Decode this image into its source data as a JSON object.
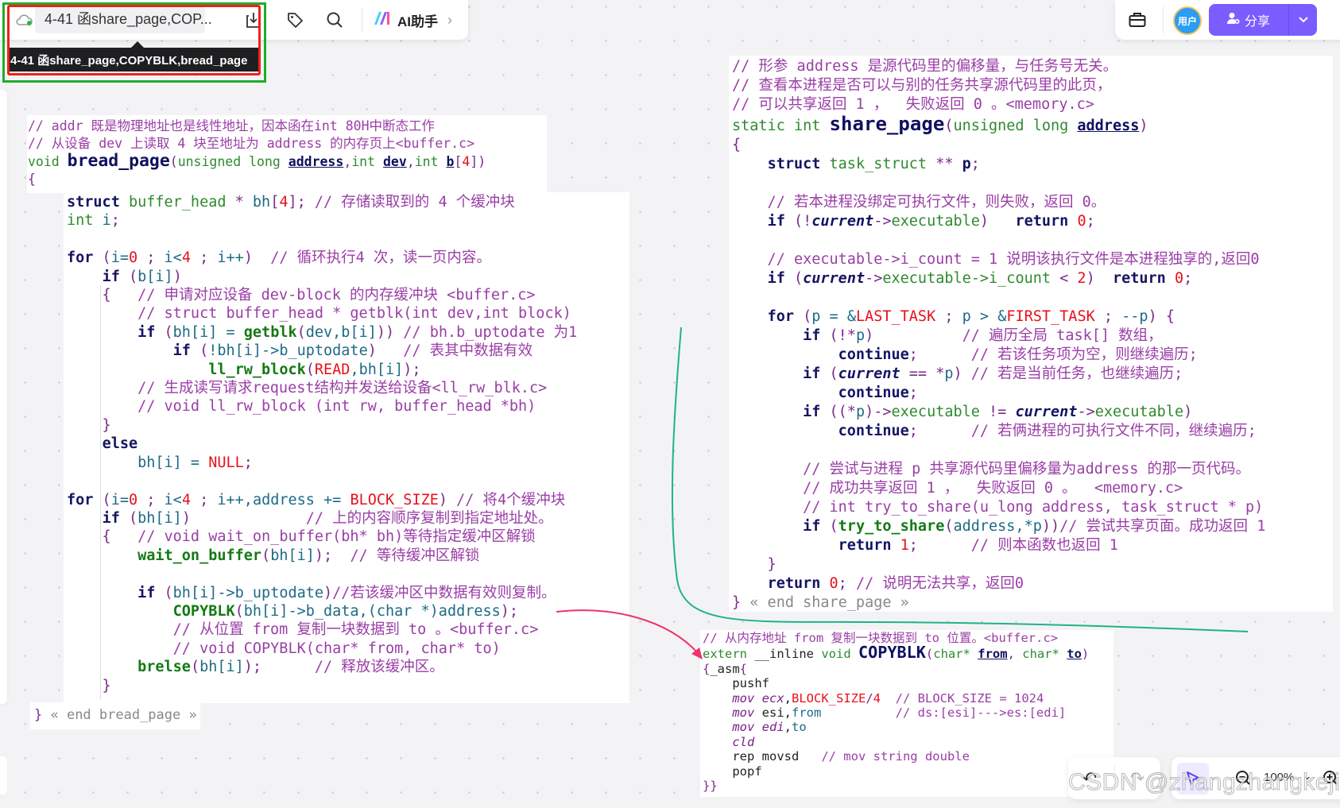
{
  "toolbar": {
    "doc_title": "4-41 函share_page,COP...",
    "tooltip": "4-41  函share_page,COPYBLK,bread_page",
    "ai_label": "AI助手",
    "avatar_text": "用户",
    "share_label": "分享",
    "zoom_level": "100%",
    "icons": [
      "cloud-sync-icon",
      "download-icon",
      "tag-icon",
      "search-icon",
      "ai-logo-icon",
      "chevron-right-icon",
      "toolbox-icon",
      "user-plus-icon",
      "chevron-down-icon",
      "undo-icon",
      "redo-icon",
      "pointer-icon",
      "zoom-out-icon",
      "zoom-in-icon"
    ],
    "accent_color": "#7b5cff"
  },
  "watermark": "CSDN @zhangzhangkeji",
  "bread_page_header": [
    [
      [
        "c",
        "// addr 既是物理地址也是线性地址，因本函在int 80H中断态工作"
      ]
    ],
    [
      [
        "c",
        "// 从设备 dev 上读取 4 块至地址为 address 的内存页上<buffer.c>"
      ]
    ],
    [
      [
        "t",
        "void "
      ],
      [
        "F",
        "bread_page"
      ],
      [
        "p",
        "("
      ],
      [
        "t",
        "unsigned long "
      ],
      [
        "u",
        "address"
      ],
      [
        "p",
        ","
      ],
      [
        "t",
        "int "
      ],
      [
        "u",
        "dev"
      ],
      [
        "p",
        ","
      ],
      [
        "t",
        "int "
      ],
      [
        "u",
        "b"
      ],
      [
        "p",
        "["
      ],
      [
        "n",
        "4"
      ],
      [
        "p",
        "])"
      ]
    ],
    [
      [
        "p",
        "{"
      ]
    ]
  ],
  "bread_page_body": [
    [
      [
        "k",
        "struct"
      ],
      [
        "t",
        " buffer_head "
      ],
      [
        "p",
        "* "
      ],
      [
        "v",
        "bh"
      ],
      [
        "p",
        "["
      ],
      [
        "n",
        "4"
      ],
      [
        "p",
        "]; "
      ],
      [
        "c",
        "// 存储读取到的 4 个缓冲块"
      ]
    ],
    [
      [
        "t",
        "int "
      ],
      [
        "v",
        "i"
      ],
      [
        "p",
        ";"
      ]
    ],
    [],
    [
      [
        "k",
        "for"
      ],
      [
        "p",
        " ("
      ],
      [
        "v",
        "i="
      ],
      [
        "n",
        "0"
      ],
      [
        "p",
        " ; "
      ],
      [
        "v",
        "i<"
      ],
      [
        "n",
        "4"
      ],
      [
        "p",
        " ; "
      ],
      [
        "v",
        "i++"
      ],
      [
        "p",
        ")  "
      ],
      [
        "c",
        "// 循环执行4 次，读一页内容。"
      ]
    ],
    [
      [
        "m",
        "    "
      ],
      [
        "k",
        "if"
      ],
      [
        "p",
        " ("
      ],
      [
        "v",
        "b[i]"
      ],
      [
        "p",
        ")"
      ]
    ],
    [
      [
        "p",
        "    {   "
      ],
      [
        "c",
        "// 申请对应设备 dev-block 的内存缓冲块 <buffer.c>"
      ]
    ],
    [
      [
        "c",
        "        // struct buffer_head * getblk(int dev,int block)"
      ]
    ],
    [
      [
        "m",
        "        "
      ],
      [
        "k",
        "if"
      ],
      [
        "p",
        " ("
      ],
      [
        "v",
        "bh[i] = "
      ],
      [
        "f",
        "getblk"
      ],
      [
        "p",
        "("
      ],
      [
        "v",
        "dev,b[i]"
      ],
      [
        "p",
        ")) "
      ],
      [
        "c",
        "// bh.b_uptodate 为1"
      ]
    ],
    [
      [
        "m",
        "            "
      ],
      [
        "k",
        "if"
      ],
      [
        "p",
        " ("
      ],
      [
        "v",
        "!bh[i]->b_uptodate"
      ],
      [
        "p",
        ")   "
      ],
      [
        "c",
        "// 表其中数据有效"
      ]
    ],
    [
      [
        "m",
        "                "
      ],
      [
        "f",
        "ll_rw_block"
      ],
      [
        "p",
        "("
      ],
      [
        "n",
        "READ"
      ],
      [
        "v",
        ",bh[i]"
      ],
      [
        "p",
        ");"
      ]
    ],
    [
      [
        "c",
        "        // 生成读写请求request结构并发送给设备<ll_rw_blk.c>"
      ]
    ],
    [
      [
        "c",
        "        // void ll_rw_block (int rw, buffer_head *bh)"
      ]
    ],
    [
      [
        "p",
        "    }"
      ]
    ],
    [
      [
        "m",
        "    "
      ],
      [
        "k",
        "else"
      ]
    ],
    [
      [
        "m",
        "        "
      ],
      [
        "v",
        "bh[i] = "
      ],
      [
        "n",
        "NULL"
      ],
      [
        "p",
        ";"
      ]
    ],
    [],
    [
      [
        "k",
        "for"
      ],
      [
        "p",
        " ("
      ],
      [
        "v",
        "i="
      ],
      [
        "n",
        "0"
      ],
      [
        "p",
        " ; "
      ],
      [
        "v",
        "i<"
      ],
      [
        "n",
        "4"
      ],
      [
        "p",
        " ; "
      ],
      [
        "v",
        "i++,address += "
      ],
      [
        "n",
        "BLOCK_SIZE"
      ],
      [
        "p",
        ") "
      ],
      [
        "c",
        "// 将4个缓冲块"
      ]
    ],
    [
      [
        "m",
        "    "
      ],
      [
        "k",
        "if"
      ],
      [
        "p",
        " ("
      ],
      [
        "v",
        "bh[i]"
      ],
      [
        "p",
        ")             "
      ],
      [
        "c",
        "// 上的内容顺序复制到指定地址处。"
      ]
    ],
    [
      [
        "p",
        "    {   "
      ],
      [
        "c",
        "// void wait_on_buffer(bh* bh)等待指定缓冲区解锁"
      ]
    ],
    [
      [
        "m",
        "        "
      ],
      [
        "f",
        "wait_on_buffer"
      ],
      [
        "p",
        "("
      ],
      [
        "v",
        "bh[i]"
      ],
      [
        "p",
        ");  "
      ],
      [
        "c",
        "// 等待缓冲区解锁"
      ]
    ],
    [],
    [
      [
        "m",
        "        "
      ],
      [
        "k",
        "if"
      ],
      [
        "p",
        " ("
      ],
      [
        "v",
        "bh[i]->b_uptodate"
      ],
      [
        "p",
        ")"
      ],
      [
        "c",
        "//若该缓冲区中数据有效则复制。"
      ]
    ],
    [
      [
        "m",
        "            "
      ],
      [
        "f",
        "COPYBLK"
      ],
      [
        "p",
        "("
      ],
      [
        "v",
        "bh[i]->b_data,(char *)address"
      ],
      [
        "p",
        ");"
      ]
    ],
    [
      [
        "c",
        "            // 从位置 from 复制一块数据到 to 。<buffer.c>"
      ]
    ],
    [
      [
        "c",
        "            // void COPYBLK(char* from, char* to)"
      ]
    ],
    [
      [
        "m",
        "        "
      ],
      [
        "f",
        "brelse"
      ],
      [
        "p",
        "("
      ],
      [
        "v",
        "bh[i]"
      ],
      [
        "p",
        ");      "
      ],
      [
        "c",
        "// 释放该缓冲区。"
      ]
    ],
    [
      [
        "p",
        "    }"
      ]
    ]
  ],
  "bread_page_end": [
    [
      "p",
      "} "
    ],
    [
      "e",
      "« end bread_page »"
    ]
  ],
  "share_page": [
    [
      [
        "c",
        "// 形参 address 是源代码里的偏移量，与任务号无关。"
      ]
    ],
    [
      [
        "c",
        "// 查看本进程是否可以与别的任务共享源代码里的此页，"
      ]
    ],
    [
      [
        "c",
        "// 可以共享返回 1 ，  失败返回 0 。<memory.c>"
      ]
    ],
    [
      [
        "t",
        "static int "
      ],
      [
        "F",
        "share_page"
      ],
      [
        "p",
        "("
      ],
      [
        "t",
        "unsigned long "
      ],
      [
        "u",
        "address"
      ],
      [
        "p",
        ")"
      ]
    ],
    [
      [
        "p",
        "{"
      ]
    ],
    [
      [
        "m",
        "    "
      ],
      [
        "k",
        "struct"
      ],
      [
        "t",
        " task_struct "
      ],
      [
        "p",
        "** "
      ],
      [
        "k",
        "p"
      ],
      [
        "p",
        ";"
      ]
    ],
    [],
    [
      [
        "c",
        "    // 若本进程没绑定可执行文件，则失败，返回 0。"
      ]
    ],
    [
      [
        "m",
        "    "
      ],
      [
        "k",
        "if"
      ],
      [
        "p",
        " (!"
      ],
      [
        "i",
        "current"
      ],
      [
        "p",
        "->"
      ],
      [
        "t",
        "executable"
      ],
      [
        "p",
        ")   "
      ],
      [
        "k",
        "return "
      ],
      [
        "n",
        "0"
      ],
      [
        "p",
        ";"
      ]
    ],
    [],
    [
      [
        "c",
        "    // executable->i_count = 1 说明该执行文件是本进程独享的,返回0"
      ]
    ],
    [
      [
        "m",
        "    "
      ],
      [
        "k",
        "if"
      ],
      [
        "p",
        " ("
      ],
      [
        "i",
        "current"
      ],
      [
        "p",
        "->"
      ],
      [
        "t",
        "executable->i_count"
      ],
      [
        "p",
        " < "
      ],
      [
        "n",
        "2"
      ],
      [
        "p",
        ")  "
      ],
      [
        "k",
        "return "
      ],
      [
        "n",
        "0"
      ],
      [
        "p",
        ";"
      ]
    ],
    [],
    [
      [
        "m",
        "    "
      ],
      [
        "k",
        "for"
      ],
      [
        "p",
        " ("
      ],
      [
        "v",
        "p = &"
      ],
      [
        "n",
        "LAST_TASK"
      ],
      [
        "p",
        " ; "
      ],
      [
        "v",
        "p > &"
      ],
      [
        "n",
        "FIRST_TASK"
      ],
      [
        "p",
        " ; "
      ],
      [
        "v",
        "--p"
      ],
      [
        "p",
        ") {"
      ]
    ],
    [
      [
        "m",
        "        "
      ],
      [
        "k",
        "if"
      ],
      [
        "p",
        " (!*"
      ],
      [
        "v",
        "p"
      ],
      [
        "p",
        ")          "
      ],
      [
        "c",
        "// 遍历全局 task[] 数组，"
      ]
    ],
    [
      [
        "m",
        "            "
      ],
      [
        "k",
        "continue"
      ],
      [
        "p",
        ";      "
      ],
      [
        "c",
        "// 若该任务项为空，则继续遍历;"
      ]
    ],
    [
      [
        "m",
        "        "
      ],
      [
        "k",
        "if"
      ],
      [
        "p",
        " ("
      ],
      [
        "i",
        "current"
      ],
      [
        "p",
        " == *"
      ],
      [
        "v",
        "p"
      ],
      [
        "p",
        ") "
      ],
      [
        "c",
        "// 若是当前任务，也继续遍历;"
      ]
    ],
    [
      [
        "m",
        "            "
      ],
      [
        "k",
        "continue"
      ],
      [
        "p",
        ";"
      ]
    ],
    [
      [
        "m",
        "        "
      ],
      [
        "k",
        "if"
      ],
      [
        "p",
        " ((*"
      ],
      [
        "v",
        "p"
      ],
      [
        "p",
        ")->"
      ],
      [
        "t",
        "executable"
      ],
      [
        "p",
        " != "
      ],
      [
        "i",
        "current"
      ],
      [
        "p",
        "->"
      ],
      [
        "t",
        "executable"
      ],
      [
        "p",
        ")"
      ]
    ],
    [
      [
        "m",
        "            "
      ],
      [
        "k",
        "continue"
      ],
      [
        "p",
        ";      "
      ],
      [
        "c",
        "// 若俩进程的可执行文件不同，继续遍历;"
      ]
    ],
    [],
    [
      [
        "c",
        "        // 尝试与进程 p 共享源代码里偏移量为address 的那一页代码。"
      ]
    ],
    [
      [
        "c",
        "        // 成功共享返回 1 ，  失败返回 0 。  <memory.c>"
      ]
    ],
    [
      [
        "c",
        "        // int try_to_share(u_long address, task_struct * p)"
      ]
    ],
    [
      [
        "m",
        "        "
      ],
      [
        "k",
        "if"
      ],
      [
        "p",
        " ("
      ],
      [
        "f",
        "try_to_share"
      ],
      [
        "p",
        "("
      ],
      [
        "v",
        "address,*p"
      ],
      [
        "p",
        "))"
      ],
      [
        "c",
        "// 尝试共享页面。成功返回 1"
      ]
    ],
    [
      [
        "m",
        "            "
      ],
      [
        "k",
        "return "
      ],
      [
        "n",
        "1"
      ],
      [
        "p",
        ";      "
      ],
      [
        "c",
        "// 则本函数也返回 1"
      ]
    ],
    [
      [
        "p",
        "    }"
      ]
    ],
    [
      [
        "m",
        "    "
      ],
      [
        "k",
        "return "
      ],
      [
        "n",
        "0"
      ],
      [
        "p",
        "; "
      ],
      [
        "c",
        "// 说明无法共享，返回0"
      ]
    ],
    [
      [
        "p",
        "} "
      ],
      [
        "e",
        "« end share_page »"
      ]
    ]
  ],
  "copyblk": [
    [
      [
        "c",
        "// 从内存地址 from 复制一块数据到 to 位置。<buffer.c>"
      ]
    ],
    [
      [
        "t",
        "extern "
      ],
      [
        "m",
        "__inline "
      ],
      [
        "t",
        "void "
      ],
      [
        "F",
        "COPYBLK"
      ],
      [
        "p",
        "("
      ],
      [
        "t",
        "char* "
      ],
      [
        "u",
        "from"
      ],
      [
        "p",
        ", "
      ],
      [
        "t",
        "char* "
      ],
      [
        "u",
        "to"
      ],
      [
        "p",
        ")"
      ]
    ],
    [
      [
        "p",
        "{"
      ],
      [
        "m",
        "_asm"
      ],
      [
        "p",
        "{"
      ]
    ],
    [
      [
        "m",
        "    pushf"
      ]
    ],
    [
      [
        "a",
        "    mov ecx"
      ],
      [
        "m",
        ","
      ],
      [
        "n",
        "BLOCK_SIZE"
      ],
      [
        "p",
        "/"
      ],
      [
        "n",
        "4"
      ],
      [
        "c",
        "  // BLOCK_SIZE = 1024"
      ]
    ],
    [
      [
        "a",
        "    mov "
      ],
      [
        "m",
        "esi,"
      ],
      [
        "v",
        "from"
      ],
      [
        "c",
        "          // ds:[esi]--->es:[edi]"
      ]
    ],
    [
      [
        "a",
        "    mov edi"
      ],
      [
        "m",
        ","
      ],
      [
        "v",
        "to"
      ]
    ],
    [
      [
        "a",
        "    cld"
      ]
    ],
    [
      [
        "m",
        "    rep movsd   "
      ],
      [
        "c",
        "// mov string double"
      ]
    ],
    [
      [
        "m",
        "    popf"
      ]
    ],
    [
      [
        "p",
        "}}"
      ]
    ]
  ]
}
